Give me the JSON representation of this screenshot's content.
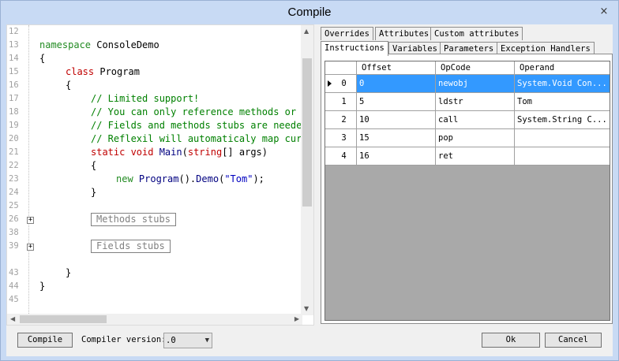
{
  "window": {
    "title": "Compile",
    "close_glyph": "×"
  },
  "code": {
    "line_numbers": [
      "12",
      "13",
      "14",
      "15",
      "16",
      "17",
      "18",
      "19",
      "20",
      "21",
      "22",
      "23",
      "24",
      "25",
      "26",
      "38",
      "39",
      "43",
      "44",
      "45"
    ],
    "ns_kw": "namespace",
    "ns_name": " ConsoleDemo",
    "brace_open": "{",
    "brace_close": "}",
    "class_kw": "class",
    "class_name": " Program",
    "comment1": "// Limited support!",
    "comment2": "// You can only reference methods or fields defined in the class (not in ancestors classes)",
    "comment3": "// Fields and methods stubs are needed for compilation purposes only.",
    "comment4": "// Reflexil will automaticaly map current type, fields or methods to original references.",
    "static_kw": "static",
    "void_kw": " void",
    "main_name": " Main",
    "paren_open": "(",
    "string_kw": "string",
    "main_rest": "[] args)",
    "new_kw": "new",
    "program_call": " Program",
    "demo_part1": "().",
    "demo_name": "Demo",
    "demo_part2": "(",
    "demo_arg": "\"Tom\"",
    "demo_end": ");",
    "methods_stub": "Methods stubs",
    "fields_stub": "Fields stubs",
    "fold_glyph": "+"
  },
  "tabs": {
    "row1": [
      "Overrides",
      "Attributes",
      "Custom attributes"
    ],
    "row2": [
      "Instructions",
      "Variables",
      "Parameters",
      "Exception Handlers"
    ]
  },
  "grid": {
    "columns": [
      "Offset",
      "OpCode",
      "Operand"
    ],
    "rows": [
      {
        "index": "0",
        "offset": "0",
        "opcode": "newobj",
        "operand": "System.Void Con..."
      },
      {
        "index": "1",
        "offset": "5",
        "opcode": "ldstr",
        "operand": "Tom"
      },
      {
        "index": "2",
        "offset": "10",
        "opcode": "call",
        "operand": "System.String C..."
      },
      {
        "index": "3",
        "offset": "15",
        "opcode": "pop",
        "operand": ""
      },
      {
        "index": "4",
        "offset": "16",
        "opcode": "ret",
        "operand": ""
      }
    ]
  },
  "bottom": {
    "compile_label": "Compile",
    "compiler_version_label": "Compiler version:",
    "compiler_version_value": ".0",
    "ok_label": "Ok",
    "cancel_label": "Cancel"
  }
}
